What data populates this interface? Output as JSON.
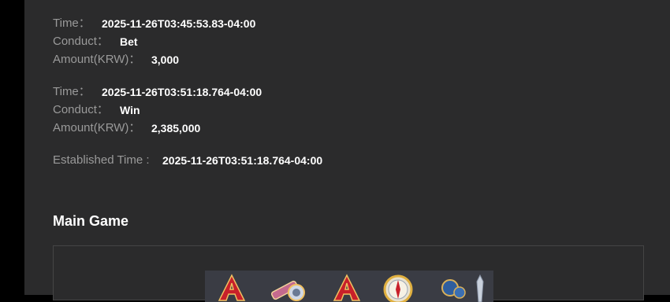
{
  "records": [
    {
      "time_label": "Time",
      "time_value": "2025-11-26T03:45:53.83-04:00",
      "conduct_label": "Conduct",
      "conduct_value": "Bet",
      "amount_label": "Amount(KRW)",
      "amount_value": "3,000"
    },
    {
      "time_label": "Time",
      "time_value": "2025-11-26T03:51:18.764-04:00",
      "conduct_label": "Conduct",
      "conduct_value": "Win",
      "amount_label": "Amount(KRW)",
      "amount_value": "2,385,000"
    }
  ],
  "established": {
    "label": "Established Time",
    "value": "2025-11-26T03:51:18.764-04:00"
  },
  "main_game": {
    "title": "Main Game",
    "symbols": [
      "letter-a-symbol",
      "telescope-symbol",
      "letter-a-symbol",
      "compass-symbol",
      "sword-symbol"
    ]
  },
  "colors": {
    "background": "#2b2b2c",
    "label": "#9a9a9a",
    "value": "#ffffff",
    "symbol_red": "#c8202a"
  }
}
